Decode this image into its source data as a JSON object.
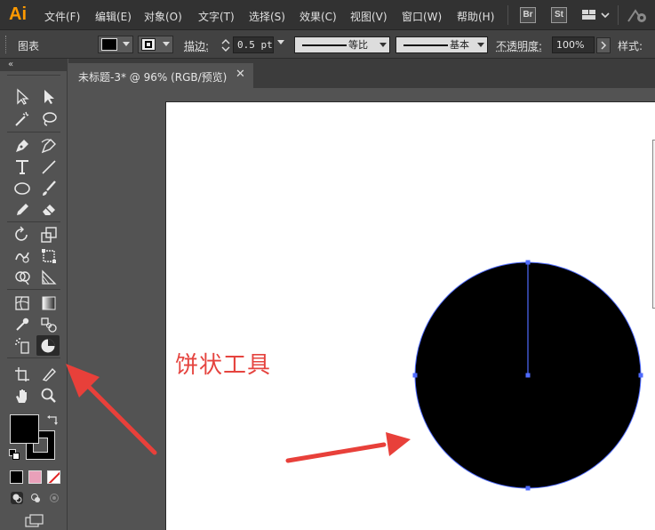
{
  "app": {
    "logo": "Ai"
  },
  "menu": [
    "文件(F)",
    "编辑(E)",
    "对象(O)",
    "文字(T)",
    "选择(S)",
    "效果(C)",
    "视图(V)",
    "窗口(W)",
    "帮助(H)"
  ],
  "app_badges": {
    "bridge": "Br",
    "stock": "St"
  },
  "control_bar": {
    "selection_label": "图表",
    "stroke_label": "描边",
    "stroke_weight": "0.5 pt",
    "profile_label": "等比",
    "brush_label": "基本",
    "opacity_label": "不透明度",
    "opacity_value": "100%",
    "style_label": "样式",
    "fill_color": "#000000"
  },
  "document_tab": {
    "title": "未标题-3* @ 96% (RGB/预览)",
    "close": "✕"
  },
  "tools": {
    "active_tool": "pie-tool",
    "fill_color": "#000000",
    "stroke_color": "#000000"
  },
  "annotation": {
    "text": "饼状工具",
    "color": "#e5443f"
  },
  "shape": {
    "type": "pie",
    "fill": "#000000",
    "selection_color": "#4f6bff"
  }
}
